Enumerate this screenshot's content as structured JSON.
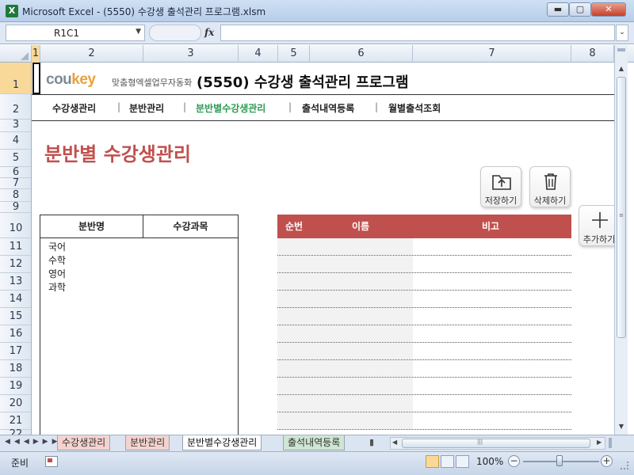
{
  "window": {
    "app_icon": "X",
    "title": "Microsoft Excel - (5550) 수강생 출석관리 프로그램.xlsm",
    "minimize": "▬",
    "maximize": "▢",
    "close": "✕"
  },
  "formula_bar": {
    "name_box": "R1C1",
    "fx": "fx",
    "formula": ""
  },
  "columns": [
    "1",
    "2",
    "3",
    "4",
    "5",
    "6",
    "7",
    "8"
  ],
  "rows": [
    "1",
    "2",
    "3",
    "4",
    "5",
    "6",
    "7",
    "8",
    "9",
    "10",
    "11",
    "12",
    "13",
    "14",
    "15",
    "16",
    "17",
    "18",
    "19",
    "20",
    "21",
    "22"
  ],
  "header": {
    "logo_cou": "cou",
    "logo_key": "key",
    "logo_tagline": "맞춤형엑셀업무자동화",
    "page_title": "(5550) 수강생 출석관리 프로그램"
  },
  "nav": {
    "items": [
      "수강생관리",
      "분반관리",
      "분반별수강생관리",
      "출석내역등록",
      "월별출석조회"
    ],
    "separator": "|",
    "active_index": 2
  },
  "section_title": "분반별 수강생관리",
  "buttons": {
    "save": "저장하기",
    "delete": "삭제하기",
    "add": "추가하기"
  },
  "class_table": {
    "headers": [
      "분반명",
      "수강과목"
    ],
    "items": [
      "국어",
      "수학",
      "영어",
      "과학"
    ]
  },
  "student_table": {
    "headers": [
      "순번",
      "이름",
      "비고"
    ],
    "row_count": 11
  },
  "sheet_tabs": {
    "tabs": [
      "수강생관리",
      "분반관리",
      "분반별수강생관리",
      "출석내역등록"
    ],
    "active_index": 2
  },
  "status": {
    "mode": "준비",
    "zoom": "100%"
  },
  "colors": {
    "accent_red": "#c0504d",
    "active_nav_green": "#2e9a55",
    "logo_orange": "#e9a23b"
  }
}
